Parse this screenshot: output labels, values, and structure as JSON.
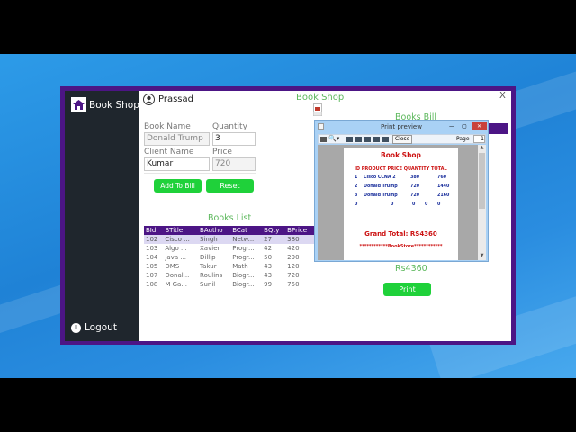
{
  "app": {
    "title": "Book Shop",
    "user": "Prassad",
    "logout_label": "Logout",
    "close_label": "X",
    "header_title": "Book Shop"
  },
  "form": {
    "book_name_label": "Book Name",
    "book_name_value": "Donald Trump",
    "quantity_label": "Quantity",
    "quantity_value": "3",
    "client_name_label": "Client Name",
    "client_name_value": "Kumar",
    "price_label": "Price",
    "price_value": "720",
    "add_button": "Add To Bill",
    "reset_button": "Reset"
  },
  "books": {
    "title": "Books List",
    "columns": [
      "BId",
      "BTitle",
      "BAutho",
      "BCat",
      "BQty",
      "BPrice"
    ],
    "rows": [
      [
        "102",
        "Cisco ...",
        "Singh",
        "Netw...",
        "27",
        "380"
      ],
      [
        "103",
        "Algo ...",
        "Xavier",
        "Progr...",
        "42",
        "420"
      ],
      [
        "104",
        "Java ...",
        "Dillip",
        "Progr...",
        "50",
        "290"
      ],
      [
        "105",
        "DMS",
        "Takur",
        "Math",
        "43",
        "120"
      ],
      [
        "107",
        "Donal...",
        "Roulins",
        "Biogr...",
        "43",
        "720"
      ],
      [
        "108",
        "M Ga...",
        "Sunil",
        "Biogr...",
        "99",
        "750"
      ]
    ]
  },
  "bill": {
    "title": "Books Bill",
    "total": "Rs4360",
    "print_button": "Print"
  },
  "preview": {
    "window_title": "Print preview",
    "close_label": "Close",
    "page_label": "Page",
    "page_value": "1",
    "doc_title": "Book Shop",
    "header": "ID PRODUCT PRICE QUANTITY TOTAL",
    "lines": [
      [
        "1",
        "Cisco CCNA 2",
        "380",
        "2",
        "760"
      ],
      [
        "2",
        "Donald Trump",
        "720",
        "2",
        "1440"
      ],
      [
        "3",
        "Donald Trump",
        "720",
        "3",
        "2160"
      ],
      [
        "0",
        "0",
        "0",
        "0",
        "0"
      ]
    ],
    "grand_total": "Grand Total: RS4360",
    "footer": "************BookStore************"
  },
  "colors": {
    "accent": "#4c1585",
    "button": "#1fd13a",
    "title": "#5cb85c"
  }
}
